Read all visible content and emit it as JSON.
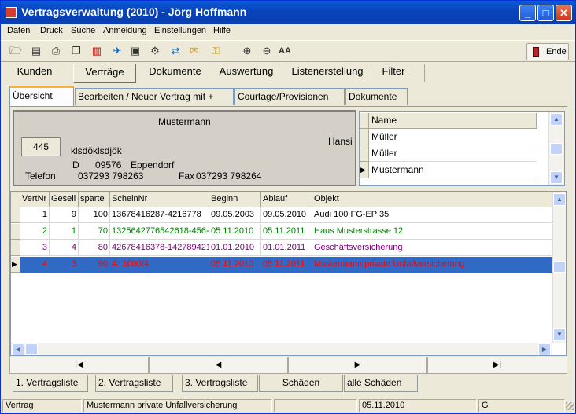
{
  "window": {
    "title": "Vertragsverwaltung (2010) - Jörg Hoffmann",
    "min": "_",
    "max": "□",
    "close": "✕"
  },
  "menu": [
    "Daten",
    "Druck",
    "Suche",
    "Anmeldung",
    "Einstellungen",
    "Hilfe"
  ],
  "toolbar": {
    "ende": "Ende",
    "icons": [
      "open-icon",
      "doc-icon",
      "print-icon",
      "copy-icon",
      "chart-icon",
      "run-icon",
      "archive-icon",
      "settings-icon",
      "transfer-icon",
      "note-icon",
      "key-icon",
      "zoom-in-icon",
      "zoom-out-icon",
      "font-icon"
    ]
  },
  "tabs": [
    "Kunden",
    "Verträge",
    "Dokumente",
    "Auswertung",
    "Listenerstellung",
    "Filter"
  ],
  "subtabs": [
    "Übersicht",
    "Bearbeiten / Neuer Vertrag mit +",
    "Courtage/Provisionen",
    "Dokumente"
  ],
  "customer": {
    "lastname": "Mustermann",
    "id": "445",
    "firstname": "Hansi",
    "street": "klsdöklsdjök",
    "country": "D",
    "zip": "09576",
    "city": "Eppendorf",
    "phone_label": "Telefon",
    "phone": "037293 798263",
    "fax_label": "Fax",
    "fax": "037293   798264"
  },
  "names": {
    "header": "Name",
    "rows": [
      "Müller",
      "Müller",
      "Mustermann"
    ]
  },
  "contracts": {
    "headers": [
      "VertNr",
      "Gesell",
      "sparte",
      "ScheinNr",
      "Beginn",
      "Ablauf",
      "Objekt"
    ],
    "rows": [
      {
        "color": "#000000",
        "cells": [
          "1",
          "9",
          "100",
          "13678416287-4216778",
          "09.05.2003",
          "09.05.2010",
          "Audi 100 FG-EP 35"
        ]
      },
      {
        "color": "#008000",
        "cells": [
          "2",
          "1",
          "70",
          "1325642776542618-456-",
          "05.11.2010",
          "05.11.2011",
          "Haus Musterstrasse 12"
        ]
      },
      {
        "color": "#800080",
        "cells": [
          "3",
          "4",
          "80",
          "42678416378-142789421",
          "01.01.2010",
          "01.01.2011",
          "Geschäftsversicherung"
        ]
      },
      {
        "color": "#ff0000",
        "cells": [
          "4",
          "3",
          "90",
          "A: 1000/4",
          "05.11.2010",
          "05.11.2011",
          "Mustermann private Unfallversicherung"
        ]
      }
    ]
  },
  "nav": [
    "|◀",
    "◀",
    "▶",
    "▶|"
  ],
  "bottom_tabs": [
    "1. Vertragsliste",
    "2. Vertragsliste",
    "3. Vertragsliste",
    "Schäden",
    "alle Schäden"
  ],
  "status": [
    "Vertrag",
    "Mustermann private Unfallversicherung",
    "",
    "05.11.2010",
    "G"
  ]
}
